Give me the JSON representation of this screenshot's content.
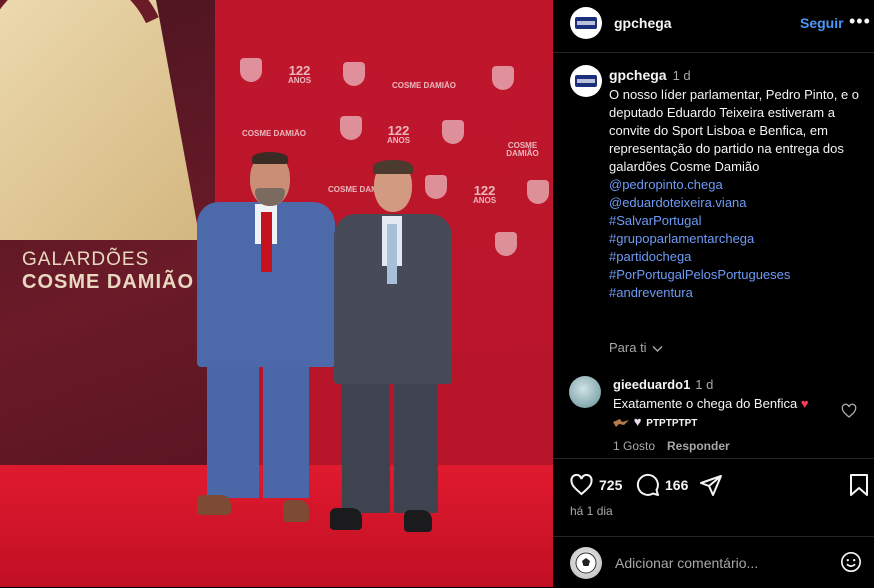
{
  "post": {
    "username": "gpchega",
    "follow_label": "Seguir",
    "more_label": "•••",
    "caption": {
      "username": "gpchega",
      "timestamp": "1 d",
      "text": "O nosso líder parlamentar, Pedro Pinto, e o deputado Eduardo Teixeira estiveram a convite do Sport Lisboa e Benfica, em representação do partido na entrega dos galardões Cosme Damião",
      "tags": [
        "@pedropinto.chega",
        "@eduardoteixeira.viana",
        "#SalvarPortugal",
        "#grupoparlamentarchega",
        "#partidochega",
        "#PorPortugalPelosPortugueses",
        "#andreventura"
      ]
    },
    "see_translation": "Para ti",
    "comment": {
      "username": "gieeduardo1",
      "timestamp": "1 d",
      "text": "Exatamente o chega do Benfica",
      "emoji_line": "PTPTPTPT",
      "likes": "1 Gosto",
      "reply_label": "Responder"
    },
    "likes_count": "725",
    "comments_count": "166",
    "time_ago": "há 1 dia",
    "add_comment_placeholder": "Adicionar comentário..."
  },
  "photo": {
    "backdrop_title_line1": "GALARDÕES",
    "backdrop_title_line2": "COSME DAMIÃO",
    "pattern_number": "122",
    "pattern_sub": "ANOS",
    "pattern_brand": "COSME DAMIÃO"
  },
  "colors": {
    "link": "#6e9bf6",
    "follow": "#4a97f5",
    "backdrop_red": "#c0162c",
    "carpet_red": "#e01a2e",
    "heart_red": "#ff3040"
  }
}
